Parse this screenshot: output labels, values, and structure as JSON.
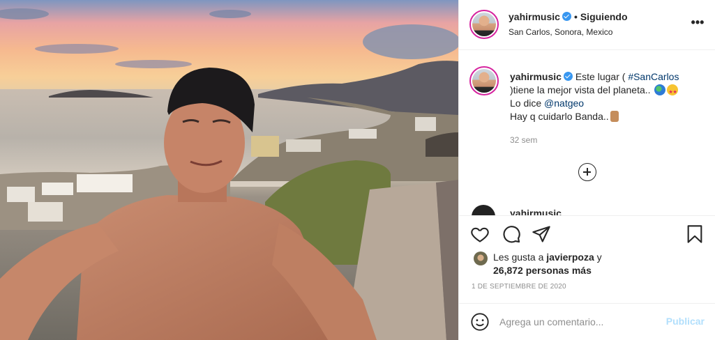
{
  "post": {
    "username": "yahirmusic",
    "separator": "•",
    "follow_status": "Siguiendo",
    "location": "San Carlos, Sonora, Mexico",
    "more_icon": "more-options-icon"
  },
  "caption": {
    "username": "yahirmusic",
    "text_part1": "Este lugar ( ",
    "hashtag": "#SanCarlos",
    "text_part2": " )tiene la mejor vista del planeta..",
    "text_part3": "Lo dice ",
    "mention": "@natgeo",
    "text_part4": "Hay q cuidarlo Banda..",
    "time": "32 sem"
  },
  "next_comment": {
    "username": "yahirmusic"
  },
  "actions": {
    "icons": [
      "heart-icon",
      "comment-icon",
      "share-icon",
      "save-icon"
    ]
  },
  "likes": {
    "prefix": "Les gusta a ",
    "user": "javierpoza",
    "suffix": " y",
    "count": "26,872 personas más"
  },
  "date": "1 DE SEPTIEMBRE DE 2020",
  "comment_box": {
    "placeholder": "Agrega un comentario...",
    "publish_label": "Publicar"
  },
  "colors": {
    "link": "#00376b",
    "verified": "#3897f0",
    "publish_disabled": "#b2dffc",
    "muted": "#8e8e8e"
  }
}
